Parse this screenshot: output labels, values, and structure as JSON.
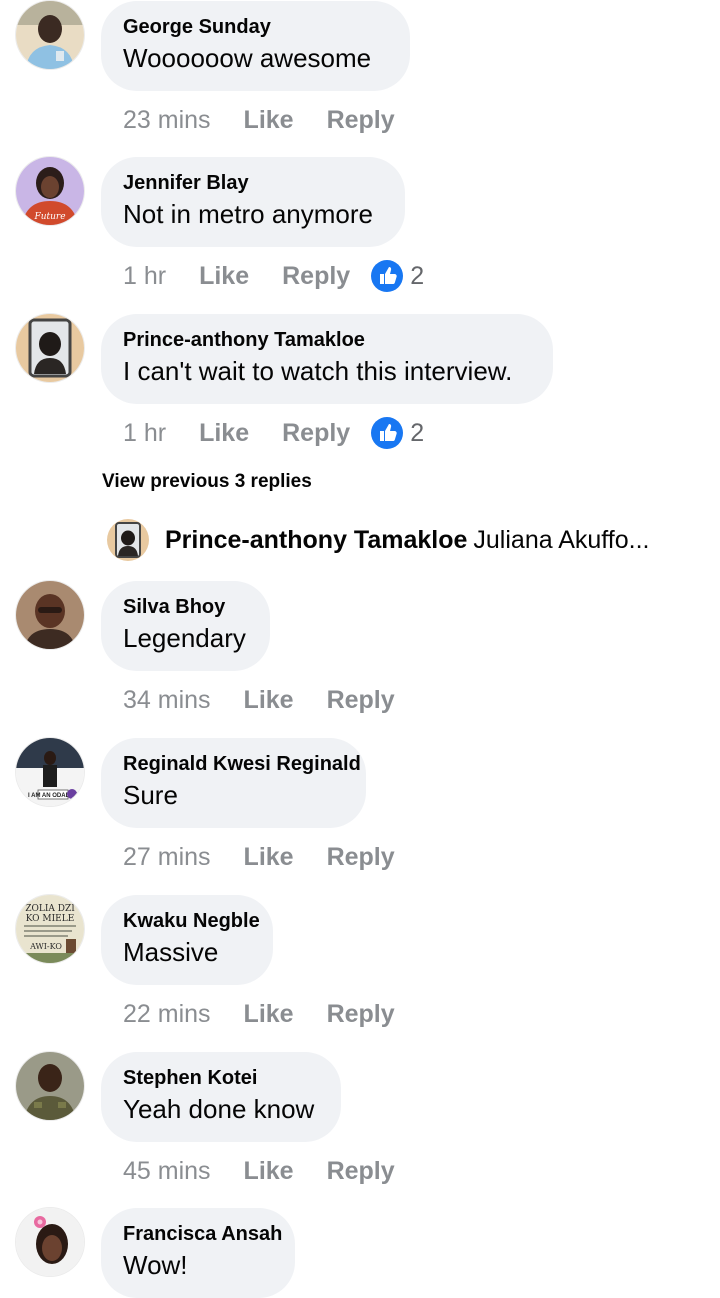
{
  "comments": [
    {
      "name": "George Sunday",
      "text": "Woooooow awesome",
      "time": "23 mins",
      "like": "Like",
      "reply": "Reply",
      "reactions": null
    },
    {
      "name": "Jennifer Blay",
      "text": "Not in metro anymore",
      "time": "1 hr",
      "like": "Like",
      "reply": "Reply",
      "reactions": "2"
    },
    {
      "name": "Prince-anthony Tamakloe",
      "text": "I can't wait to watch this interview.",
      "time": "1 hr",
      "like": "Like",
      "reply": "Reply",
      "reactions": "2"
    },
    {
      "name": "Silva Bhoy",
      "text": "Legendary",
      "time": "34 mins",
      "like": "Like",
      "reply": "Reply",
      "reactions": null
    },
    {
      "name": "Reginald Kwesi Reginald",
      "text": "Sure",
      "time": "27 mins",
      "like": "Like",
      "reply": "Reply",
      "reactions": null
    },
    {
      "name": "Kwaku Negble",
      "text": "Massive",
      "time": "22 mins",
      "like": "Like",
      "reply": "Reply",
      "reactions": null
    },
    {
      "name": "Stephen Kotei",
      "text": "Yeah done know",
      "time": "45 mins",
      "like": "Like",
      "reply": "Reply",
      "reactions": null
    },
    {
      "name": "Francisca Ansah",
      "text": "Wow!",
      "time": "",
      "like": "",
      "reply": "",
      "reactions": null
    }
  ],
  "thread": {
    "view_previous": "View previous 3 replies",
    "reply_author": "Prince-anthony Tamakloe",
    "reply_text": "Juliana Akuffo..."
  },
  "avatar_text": {
    "jennifer": "Future",
    "reginald": "I AM AN ODADEE",
    "kwaku_line1": "ZOLIA DZI",
    "kwaku_line2": "KO MIELE",
    "kwaku_line3": "AWI-KO"
  },
  "colors": {
    "bubble": "#f0f2f5",
    "meta": "#8a8d91",
    "like_blue": "#1877f2"
  }
}
